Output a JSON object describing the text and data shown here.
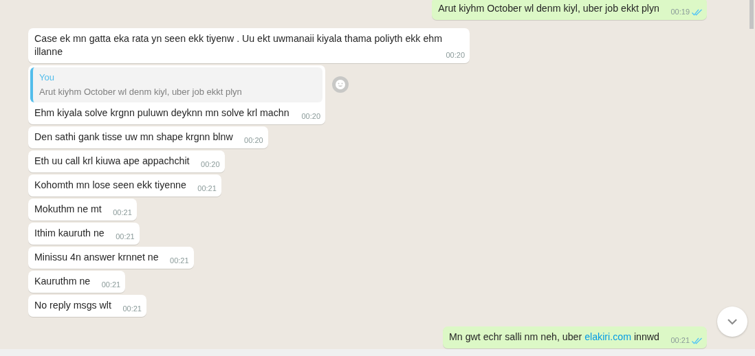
{
  "messages": [
    {
      "outgoing": true,
      "text": "Arut kiyhm October wl denm kiyl, uber job ekkt plyn",
      "time": "00:19",
      "read": true
    },
    {
      "outgoing": false,
      "text": "Case ek mn gatta eka rata yn seen ekk tiyenw . Uu ekt uwmanaii kiyala thama poliyth ekk ehm illanne",
      "time": "00:20"
    },
    {
      "outgoing": false,
      "quote": {
        "author": "You",
        "text": "Arut kiyhm October wl denm kiyl, uber job ekkt plyn"
      },
      "text": "Ehm kiyala solve krgnn puluwn deyknn mn solve krl machn",
      "time": "00:20"
    },
    {
      "outgoing": false,
      "text": "Den sathi gank tisse uw mn shape krgnn blnw",
      "time": "00:20"
    },
    {
      "outgoing": false,
      "text": "Eth uu call krl kiuwa ape appachchit",
      "time": "00:20"
    },
    {
      "outgoing": false,
      "text": "Kohomth mn lose seen ekk tiyenne",
      "time": "00:21"
    },
    {
      "outgoing": false,
      "text": "Mokuthm ne mt",
      "time": "00:21"
    },
    {
      "outgoing": false,
      "text": "Ithim kauruth ne",
      "time": "00:21"
    },
    {
      "outgoing": false,
      "text": "Minissu 4n answer krnnet ne",
      "time": "00:21"
    },
    {
      "outgoing": false,
      "text": "Kauruthm ne",
      "time": "00:21"
    },
    {
      "outgoing": false,
      "text": "No reply msgs wlt",
      "time": "00:21"
    },
    {
      "outgoing": true,
      "text": "Mn gwt echr salli nm neh, uber ",
      "link": "elakiri.com",
      "text_after": " innwd",
      "time": "00:21",
      "read": true
    }
  ]
}
